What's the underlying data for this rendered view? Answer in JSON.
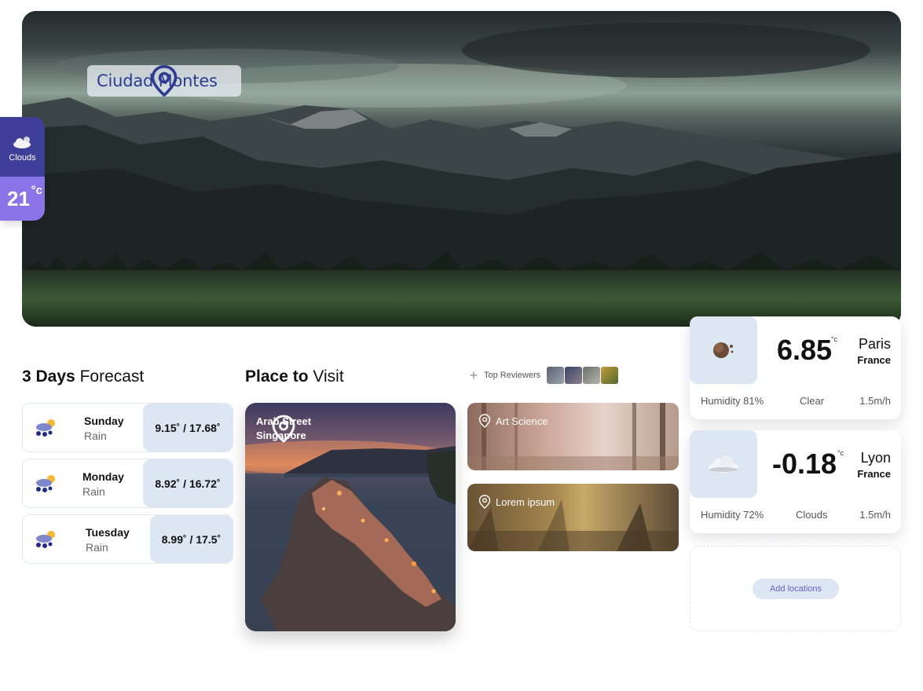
{
  "hero": {
    "location": "Ciudad Montes"
  },
  "current": {
    "condition": "Clouds",
    "temperature": "21",
    "unit": "°c"
  },
  "forecast": {
    "title_bold": "3 Days",
    "title_rest": "Forecast",
    "days": [
      {
        "day": "Sunday",
        "desc": "Rain",
        "range": "9.15˚ / 17.68˚"
      },
      {
        "day": "Monday",
        "desc": "Rain",
        "range": "8.92˚ / 16.72˚"
      },
      {
        "day": "Tuesday",
        "desc": "Rain",
        "range": "8.99˚ / 17.5˚"
      }
    ]
  },
  "places": {
    "title_bold": "Place to",
    "title_rest": "Visit",
    "top_reviewers_label": "Top Reviewers",
    "featured": {
      "line1": "Arab Street",
      "line2": "Singapore"
    },
    "items": [
      {
        "label": "Art Science"
      },
      {
        "label": "Lorem ipsum"
      }
    ]
  },
  "cities": [
    {
      "temp": "6.85",
      "unit": "°c",
      "city": "Paris",
      "country": "France",
      "humidity": "Humidity 81%",
      "condition": "Clear",
      "wind": "1.5m/h",
      "icon": "moon-icon"
    },
    {
      "temp": "-0.18",
      "unit": "°c",
      "city": "Lyon",
      "country": "France",
      "humidity": "Humidity 72%",
      "condition": "Clouds",
      "wind": "1.5m/h",
      "icon": "cloud-icon"
    }
  ],
  "add_locations": "Add locations",
  "colors": {
    "accent_dark": "#3f3f99",
    "accent_light": "#8a74e8",
    "chip_bg": "#dde6f3",
    "pill_text": "#2e3c8f"
  }
}
